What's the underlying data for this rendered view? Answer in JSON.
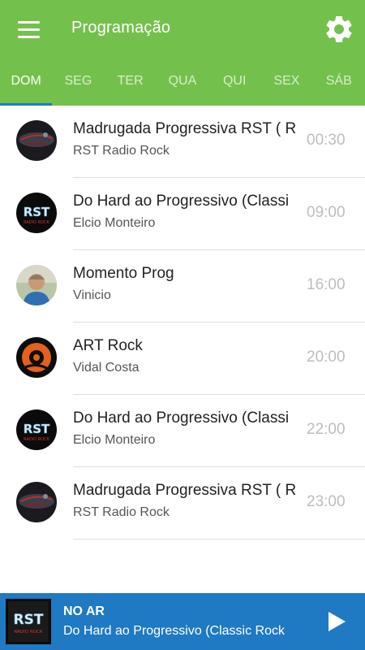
{
  "header": {
    "title": "Programação",
    "menu_icon": "hamburger-menu-icon",
    "settings_icon": "gear-icon"
  },
  "tabs": [
    {
      "label": "DOM",
      "active": true
    },
    {
      "label": "SEG"
    },
    {
      "label": "TER"
    },
    {
      "label": "QUA"
    },
    {
      "label": "QUI"
    },
    {
      "label": "SEX"
    },
    {
      "label": "SÁB"
    }
  ],
  "schedule": [
    {
      "name": "Madrugada Progressiva RST ( R",
      "host": "RST Radio Rock",
      "time": "00:30",
      "avatar": "stage-logo"
    },
    {
      "name": "Do Hard ao Progressivo (Classi",
      "host": "Elcio Monteiro",
      "time": "09:00",
      "avatar": "rst-logo"
    },
    {
      "name": "Momento Prog",
      "host": "Vinicio",
      "time": "16:00",
      "avatar": "person-photo"
    },
    {
      "name": "ART Rock",
      "host": "Vidal Costa",
      "time": "20:00",
      "avatar": "art-rock-logo"
    },
    {
      "name": "Do Hard ao Progressivo (Classi",
      "host": "Elcio Monteiro",
      "time": "22:00",
      "avatar": "rst-logo"
    },
    {
      "name": "Madrugada Progressiva RST ( R",
      "host": "RST Radio Rock",
      "time": "23:00",
      "avatar": "stage-logo"
    }
  ],
  "player": {
    "status": "NO AR",
    "now_playing": "Do Hard ao Progressivo (Classic Rock",
    "play_icon": "play-icon",
    "thumb_logo_text": "RST",
    "thumb_logo_sub": "RADIO ROCK"
  },
  "colors": {
    "appbar": "#74c04c",
    "tab_indicator": "#1f7bc7",
    "player_bar": "#1f79c3"
  }
}
